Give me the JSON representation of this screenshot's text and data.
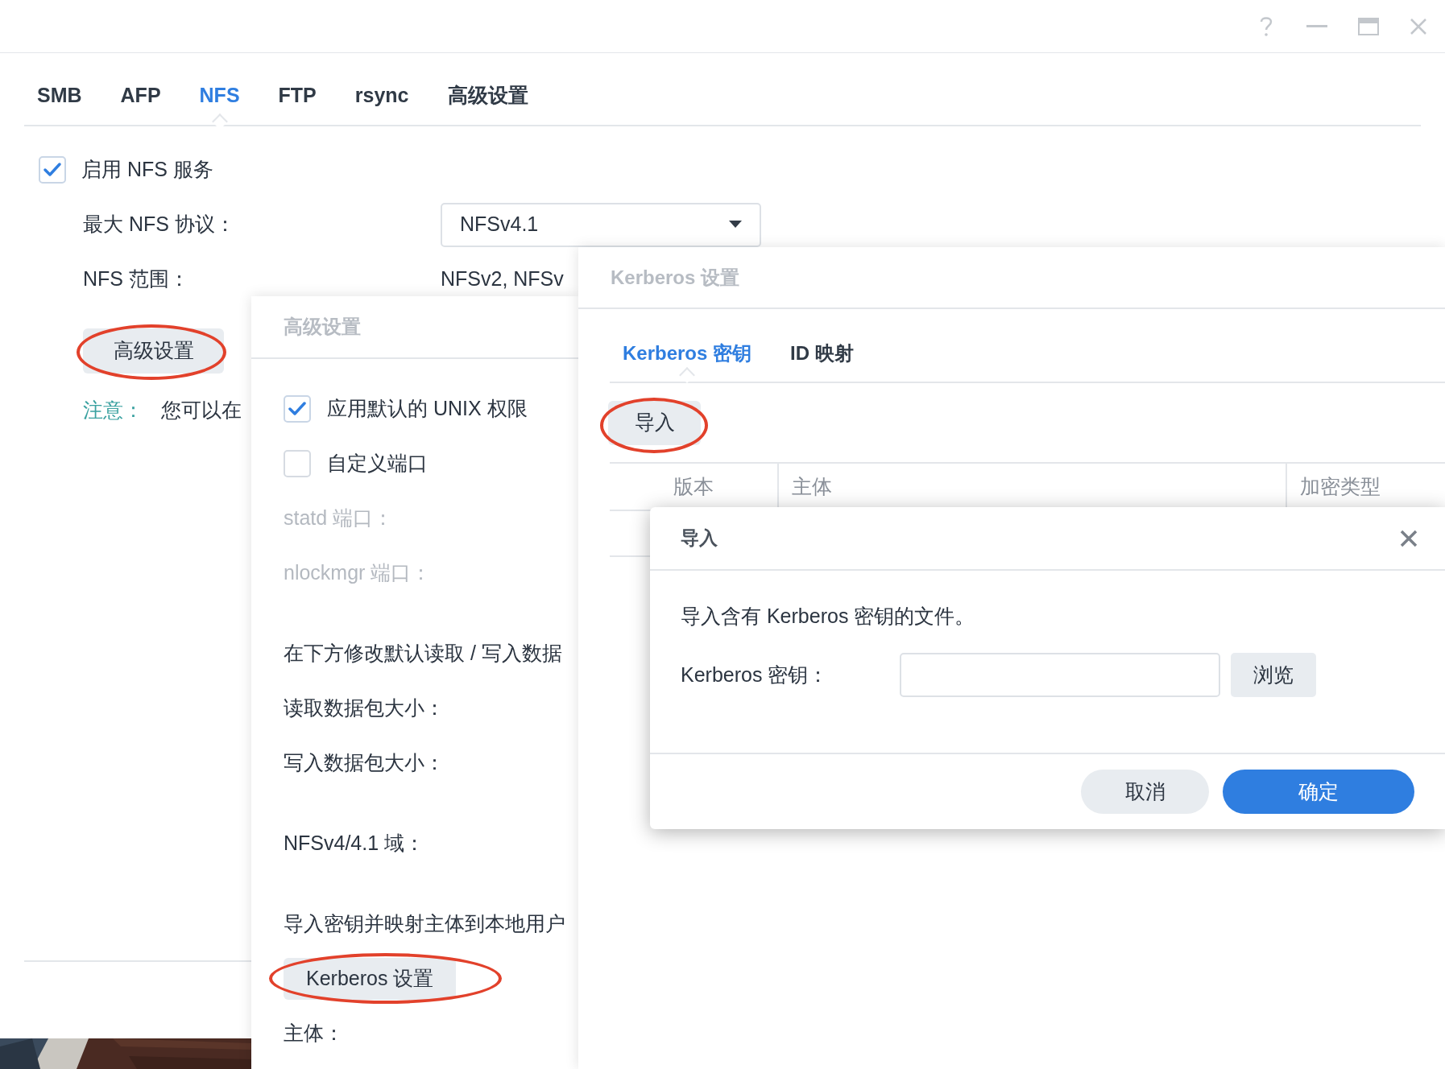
{
  "tabs": [
    {
      "label": "SMB",
      "selected": false
    },
    {
      "label": "AFP",
      "selected": false
    },
    {
      "label": "NFS",
      "selected": true
    },
    {
      "label": "FTP",
      "selected": false
    },
    {
      "label": "rsync",
      "selected": false
    },
    {
      "label": "高级设置",
      "selected": false
    }
  ],
  "nfs": {
    "enable": {
      "label": "启用 NFS 服务",
      "checked": true
    },
    "max_protocol_label": "最大 NFS 协议：",
    "max_protocol_value": "NFSv4.1",
    "range_label": "NFS 范围：",
    "range_value": "NFSv2, NFSv",
    "advanced_button": "高级设置",
    "note_label": "注意：",
    "note_text": "您可以在"
  },
  "advanced_dialog": {
    "title": "高级设置",
    "sections": [
      [
        {
          "kind": "checkbox",
          "label": "应用默认的 UNIX 权限",
          "checked": true
        },
        {
          "kind": "checkbox",
          "label": "自定义端口",
          "checked": false
        },
        {
          "kind": "label",
          "label": "statd 端口：",
          "disabled": true
        },
        {
          "kind": "label",
          "label": "nlockmgr 端口：",
          "disabled": true
        }
      ],
      [
        {
          "kind": "text",
          "label": "在下方修改默认读取 / 写入数据"
        },
        {
          "kind": "label",
          "label": "读取数据包大小：",
          "disabled": false
        },
        {
          "kind": "label",
          "label": "写入数据包大小：",
          "disabled": false
        }
      ],
      [
        {
          "kind": "label",
          "label": "NFSv4/4.1 域：",
          "disabled": false
        }
      ],
      [
        {
          "kind": "text",
          "label": "导入密钥并映射主体到本地用户"
        },
        {
          "kind": "button",
          "label": "Kerberos 设置"
        },
        {
          "kind": "label",
          "label": "主体：",
          "disabled": false
        }
      ]
    ]
  },
  "kerberos_dialog": {
    "title": "Kerberos 设置",
    "tabs": [
      {
        "label": "Kerberos 密钥",
        "selected": true
      },
      {
        "label": "ID 映射",
        "selected": false
      }
    ],
    "import_button": "导入",
    "columns": [
      "版本",
      "主体",
      "加密类型"
    ]
  },
  "import_dialog": {
    "title": "导入",
    "message": "导入含有 Kerberos 密钥的文件。",
    "key_label": "Kerberos 密钥：",
    "browse_button": "浏览",
    "buttons": [
      {
        "label": "取消",
        "kind": "secondary"
      },
      {
        "label": "确定",
        "kind": "primary"
      }
    ]
  }
}
